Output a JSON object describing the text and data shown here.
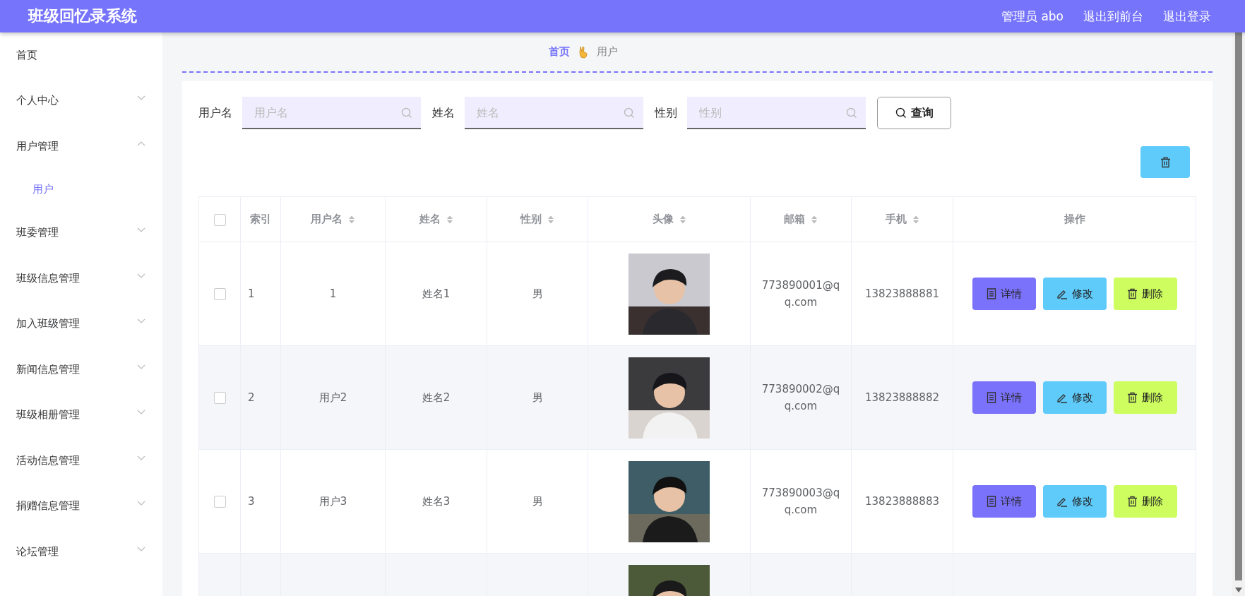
{
  "header": {
    "title": "班级回忆录系统",
    "links": [
      "管理员 abo",
      "退出到前台",
      "退出登录"
    ]
  },
  "sidebar": {
    "items": [
      {
        "label": "首页",
        "kind": "link",
        "selected": false
      },
      {
        "label": "个人中心",
        "kind": "menu",
        "expanded": false
      },
      {
        "label": "用户管理",
        "kind": "menu",
        "expanded": true,
        "children": [
          {
            "label": "用户",
            "selected": true
          }
        ]
      },
      {
        "label": "班委管理",
        "kind": "menu",
        "expanded": false
      },
      {
        "label": "班级信息管理",
        "kind": "menu",
        "expanded": false
      },
      {
        "label": "加入班级管理",
        "kind": "menu",
        "expanded": false
      },
      {
        "label": "新闻信息管理",
        "kind": "menu",
        "expanded": false
      },
      {
        "label": "班级相册管理",
        "kind": "menu",
        "expanded": false
      },
      {
        "label": "活动信息管理",
        "kind": "menu",
        "expanded": false
      },
      {
        "label": "捐赠信息管理",
        "kind": "menu",
        "expanded": false
      },
      {
        "label": "论坛管理",
        "kind": "menu",
        "expanded": false
      }
    ]
  },
  "breadcrumb": [
    "首页",
    "用户"
  ],
  "search": {
    "fields": [
      {
        "label": "用户名",
        "placeholder": "用户名"
      },
      {
        "label": "姓名",
        "placeholder": "姓名"
      },
      {
        "label": "性别",
        "placeholder": "性别"
      }
    ],
    "button": "查询"
  },
  "table": {
    "all_checked": false,
    "columns": [
      {
        "label": "索引",
        "sortable": false
      },
      {
        "label": "用户名",
        "sortable": true
      },
      {
        "label": "姓名",
        "sortable": true
      },
      {
        "label": "性别",
        "sortable": true
      },
      {
        "label": "头像",
        "sortable": true
      },
      {
        "label": "邮箱",
        "sortable": true
      },
      {
        "label": "手机",
        "sortable": true
      },
      {
        "label": "操作",
        "sortable": false
      }
    ],
    "rows": [
      {
        "checked": false,
        "index": "1",
        "username": "1",
        "name": "姓名1",
        "gender": "男",
        "avatar": {
          "kind": "picture"
        },
        "email": "773890001@qq.com",
        "phone": "13823888881",
        "actions": [
          {
            "kind": "detail",
            "label": "详情"
          },
          {
            "kind": "edit",
            "label": "修改"
          },
          {
            "kind": "delete",
            "label": "删除"
          }
        ]
      },
      {
        "checked": false,
        "index": "2",
        "username": "用户2",
        "name": "姓名2",
        "gender": "男",
        "avatar": {
          "kind": "picture"
        },
        "email": "773890002@qq.com",
        "phone": "13823888882",
        "actions": [
          {
            "kind": "detail",
            "label": "详情"
          },
          {
            "kind": "edit",
            "label": "修改"
          },
          {
            "kind": "delete",
            "label": "删除"
          }
        ]
      },
      {
        "checked": false,
        "index": "3",
        "username": "用户3",
        "name": "姓名3",
        "gender": "男",
        "avatar": {
          "kind": "picture"
        },
        "email": "773890003@qq.com",
        "phone": "13823888883",
        "actions": [
          {
            "kind": "detail",
            "label": "详情"
          },
          {
            "kind": "edit",
            "label": "修改"
          },
          {
            "kind": "delete",
            "label": "删除"
          }
        ]
      },
      {
        "avatar": {
          "kind": "picture"
        }
      }
    ]
  }
}
